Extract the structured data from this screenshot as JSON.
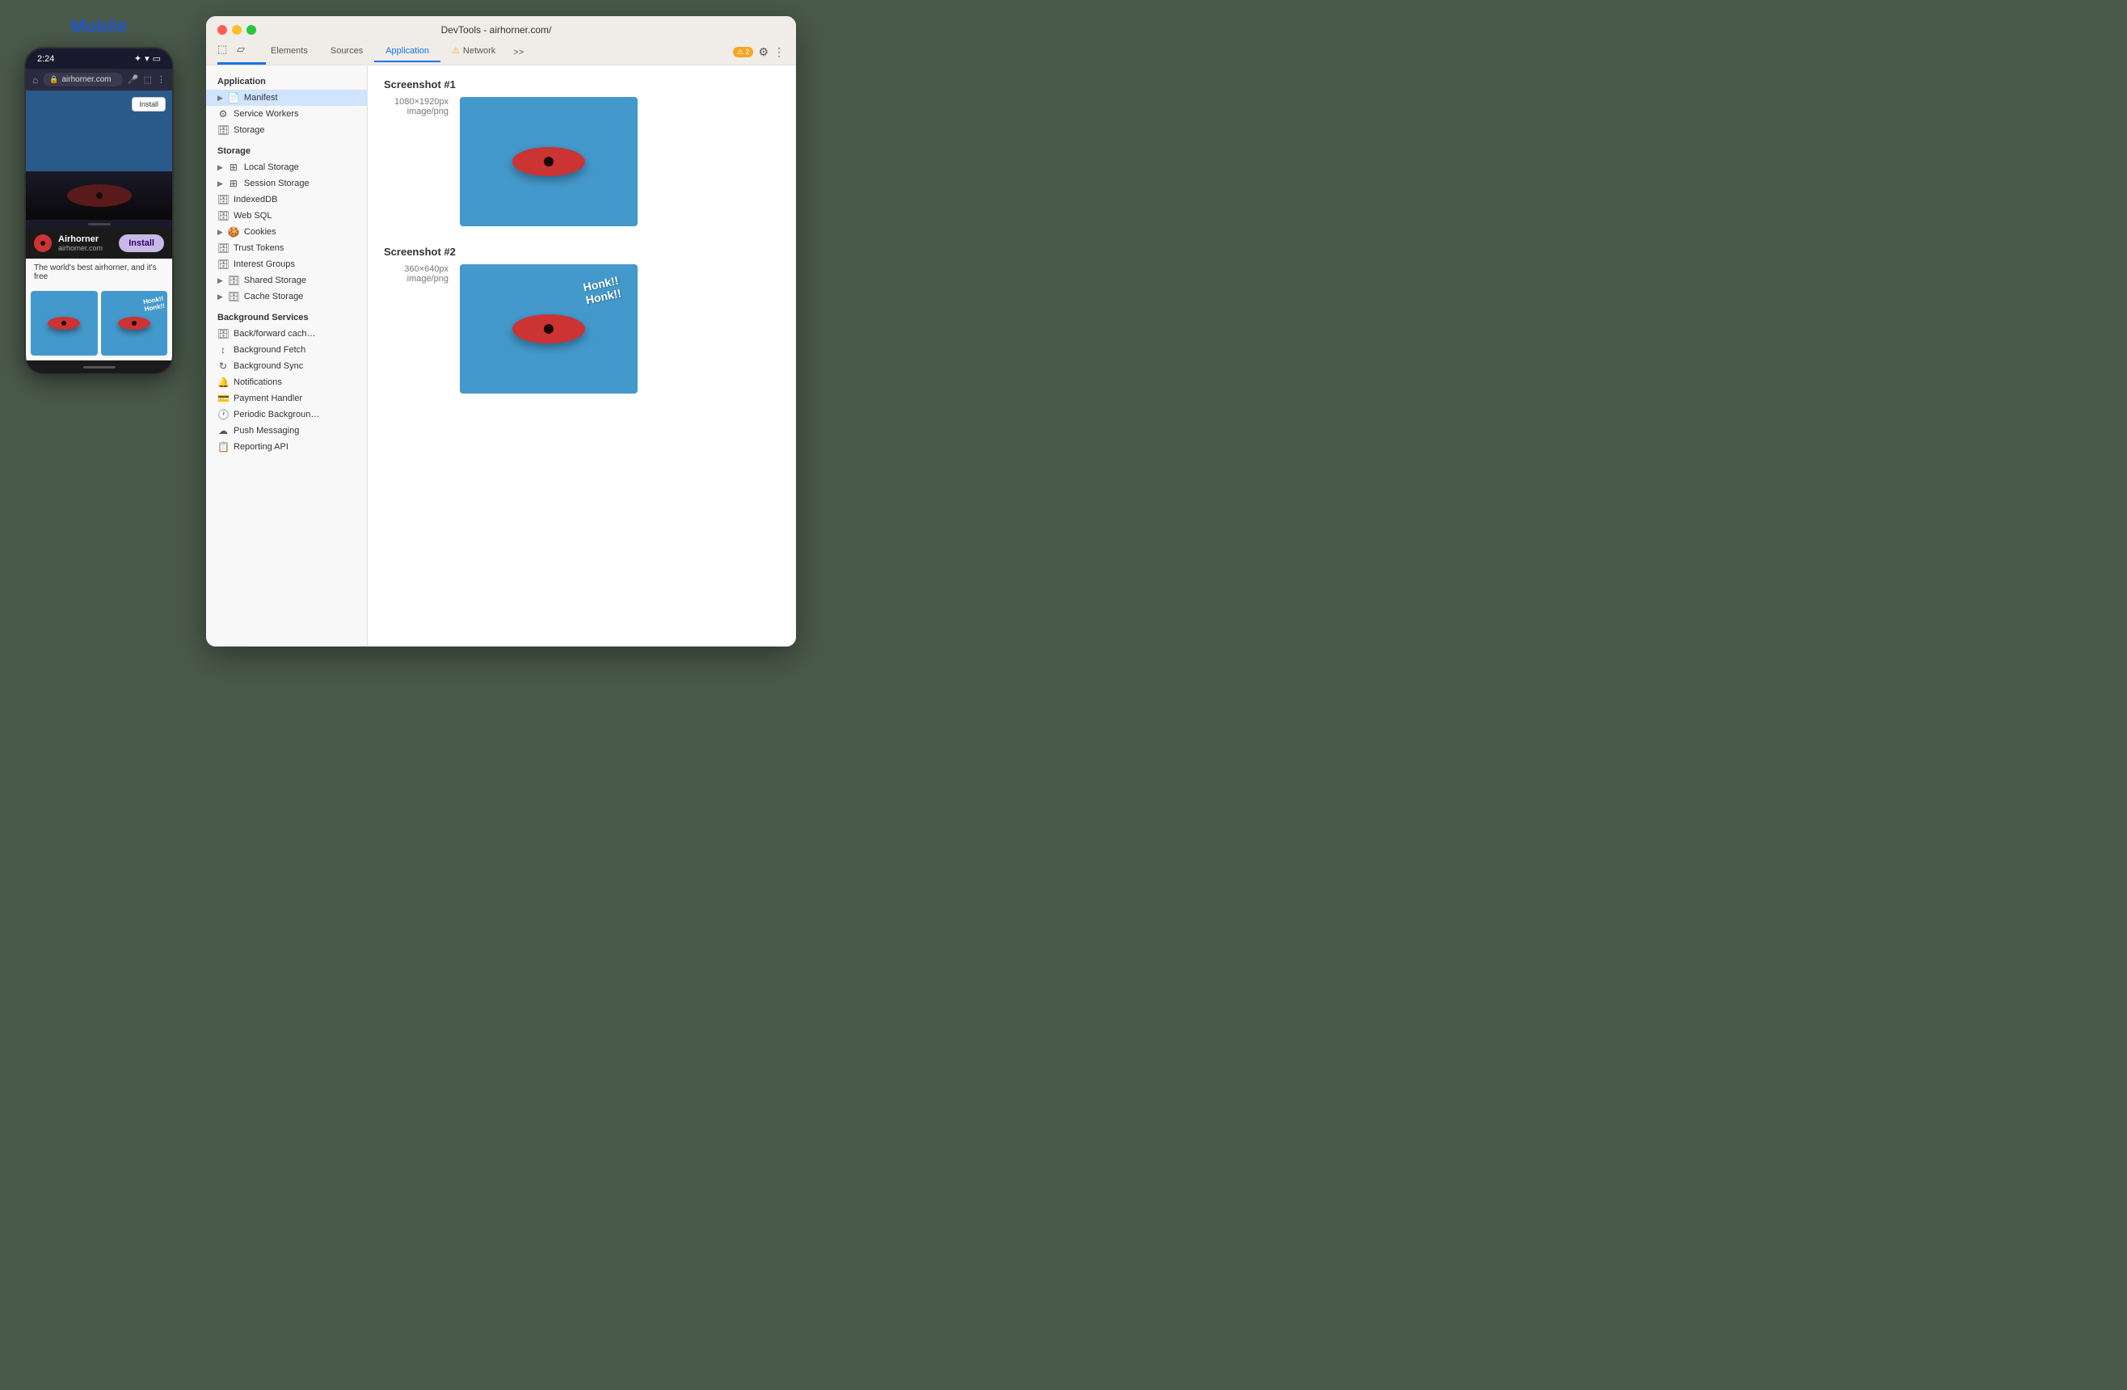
{
  "mobile": {
    "title": "Mobile",
    "status_bar": {
      "time": "2:24",
      "icons": [
        "bluetooth",
        "wifi",
        "battery"
      ]
    },
    "address_bar": {
      "url": "airhorner.com"
    },
    "install_button_top": "Install",
    "banner": {
      "app_name": "Airhorner",
      "url": "airhorner.com",
      "install_label": "Install"
    },
    "description": "The world's best airhorner, and it's free",
    "honk_text": "Honk!!\nHonk!!"
  },
  "devtools": {
    "title": "DevTools - airhorner.com/",
    "tabs": [
      {
        "id": "elements",
        "label": "Elements",
        "active": false
      },
      {
        "id": "sources",
        "label": "Sources",
        "active": false
      },
      {
        "id": "application",
        "label": "Application",
        "active": true
      },
      {
        "id": "network",
        "label": "Network",
        "active": false,
        "warning": true
      }
    ],
    "tab_more": ">>",
    "warning_count": "⚠ 2",
    "sidebar": {
      "sections": [
        {
          "title": "Application",
          "items": [
            {
              "id": "manifest",
              "label": "Manifest",
              "icon": "📄",
              "arrow": "▶",
              "active": true
            },
            {
              "id": "service-workers",
              "label": "Service Workers",
              "icon": "⚙️"
            },
            {
              "id": "storage",
              "label": "Storage",
              "icon": "🗄"
            }
          ]
        },
        {
          "title": "Storage",
          "items": [
            {
              "id": "local-storage",
              "label": "Local Storage",
              "icon": "⊞",
              "arrow": "▶"
            },
            {
              "id": "session-storage",
              "label": "Session Storage",
              "icon": "⊞",
              "arrow": "▶"
            },
            {
              "id": "indexeddb",
              "label": "IndexedDB",
              "icon": "🗄"
            },
            {
              "id": "web-sql",
              "label": "Web SQL",
              "icon": "🗄"
            },
            {
              "id": "cookies",
              "label": "Cookies",
              "icon": "🍪",
              "arrow": "▶"
            },
            {
              "id": "trust-tokens",
              "label": "Trust Tokens",
              "icon": "🗄"
            },
            {
              "id": "interest-groups",
              "label": "Interest Groups",
              "icon": "🗄"
            },
            {
              "id": "shared-storage",
              "label": "Shared Storage",
              "icon": "🗄",
              "arrow": "▶"
            },
            {
              "id": "cache-storage",
              "label": "Cache Storage",
              "icon": "🗄",
              "arrow": "▶"
            }
          ]
        },
        {
          "title": "Background Services",
          "items": [
            {
              "id": "back-forward-cache",
              "label": "Back/forward cache",
              "icon": "🗄"
            },
            {
              "id": "background-fetch",
              "label": "Background Fetch",
              "icon": "↕"
            },
            {
              "id": "background-sync",
              "label": "Background Sync",
              "icon": "↻"
            },
            {
              "id": "notifications",
              "label": "Notifications",
              "icon": "🔔"
            },
            {
              "id": "payment-handler",
              "label": "Payment Handler",
              "icon": "💳"
            },
            {
              "id": "periodic-background",
              "label": "Periodic Backgroun…",
              "icon": "🕐"
            },
            {
              "id": "push-messaging",
              "label": "Push Messaging",
              "icon": "☁"
            },
            {
              "id": "reporting-api",
              "label": "Reporting API",
              "icon": "📋"
            }
          ]
        }
      ]
    },
    "main": {
      "screenshots": [
        {
          "id": "screenshot-1",
          "title": "Screenshot #1",
          "dims": "1080×1920px",
          "type": "image/png",
          "has_honk": false
        },
        {
          "id": "screenshot-2",
          "title": "Screenshot #2",
          "dims": "360×640px",
          "type": "image/png",
          "has_honk": true,
          "honk_text": "Honk!!\nHonk!!"
        }
      ]
    }
  }
}
